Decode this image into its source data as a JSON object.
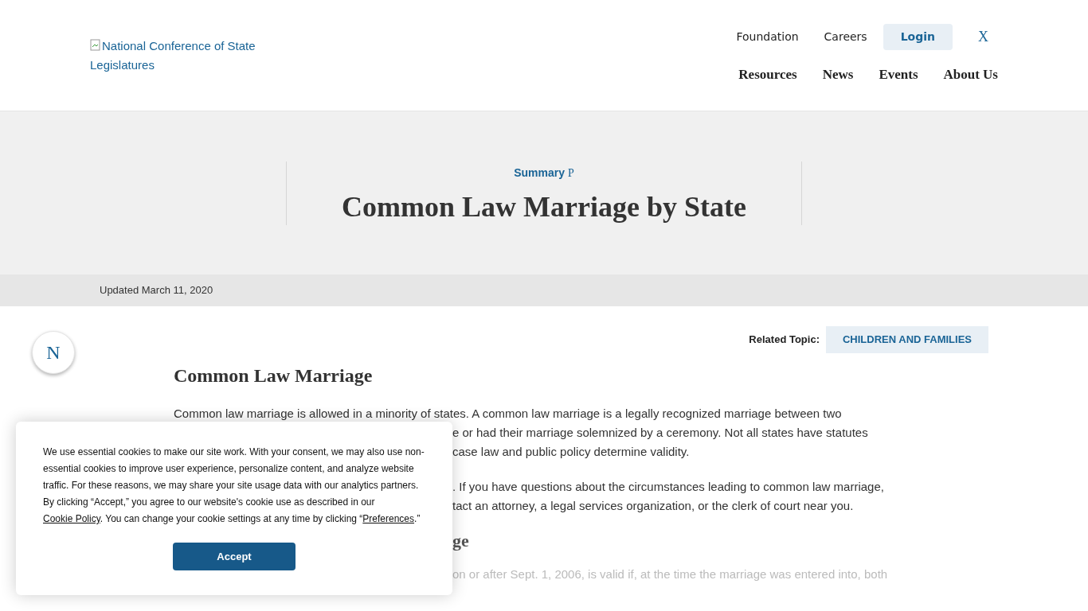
{
  "header": {
    "logo_alt": "National Conference of State Legislatures",
    "top_links": [
      {
        "label": "Foundation",
        "kind": "link"
      },
      {
        "label": "Careers",
        "kind": "link"
      },
      {
        "label": "Login",
        "kind": "button"
      },
      {
        "label": "X",
        "kind": "social"
      }
    ],
    "main_nav": [
      "Resources",
      "News",
      "Events",
      "About Us"
    ]
  },
  "hero": {
    "eyebrow": "Summary",
    "eyebrow_icon": "P",
    "title": "Common Law Marriage by State"
  },
  "updated": "Updated March 11, 2020",
  "side_button": "N",
  "related": {
    "label": "Related Topic:",
    "tag": "CHILDREN AND FAMILIES"
  },
  "article": {
    "heading": "Common Law Marriage",
    "blocks": [
      {
        "kind": "para",
        "lines": [
          {
            "text": "Common law marriage is allowed in a minority of states. A common law marriage is a legally recognized marriage between two",
            "kind": "full"
          },
          {
            "text": "e or had their marriage solemnized by a ceremony. Not all states have statutes",
            "kind": "fragment"
          },
          {
            "text": "case law and public policy determine validity.",
            "kind": "fragment"
          }
        ]
      },
      {
        "kind": "para",
        "lines": [
          {
            "text": ". If you have questions about the circumstances leading to common law marriage,",
            "kind": "fragment"
          },
          {
            "text": "tact an attorney, a legal services organization, or the clerk of court near you.",
            "kind": "fragment"
          }
        ]
      },
      {
        "kind": "heading",
        "lines": [
          {
            "text": "ge",
            "kind": "fragment"
          }
        ]
      },
      {
        "kind": "faded",
        "lines": [
          {
            "text": "on or after Sept. 1, 2006, is valid if, at the time the marriage was entered into, both",
            "kind": "fragment"
          }
        ]
      }
    ]
  },
  "cookie_banner": {
    "text": "We use essential cookies to make our site work. With your consent, we may also use non-essential cookies to improve user experience, personalize content, and analyze website traffic. For these reasons, we may share your site usage data with our analytics partners. By clicking “Accept,” you agree to our website's cookie use as described in our ",
    "link1": "Cookie Policy",
    "middle": ". You can change your cookie settings at any time by clicking “",
    "link2": "Preferences",
    "end": ".”",
    "button": "Accept"
  }
}
